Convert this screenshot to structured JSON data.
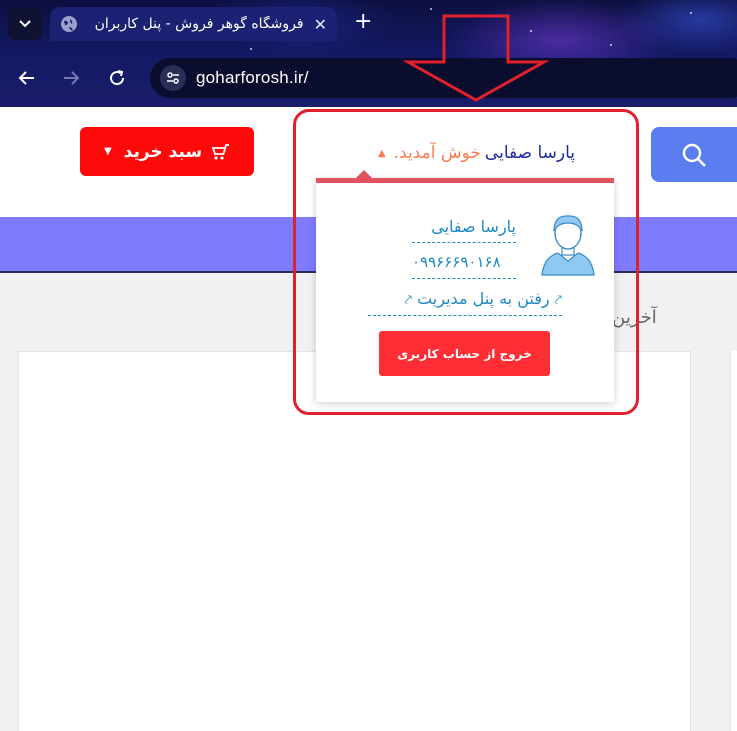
{
  "browser": {
    "tab_title": "فروشگاه گوهر فروش - پنل کاربران",
    "new_tab_symbol": "+",
    "close_symbol": "✕",
    "url": "goharforosh.ir/"
  },
  "header": {
    "cart_label": "سبد خرید",
    "cart_caret": "▼",
    "greeting_name": "پارسا صفایی",
    "greeting_welcome": "خوش آمدید.",
    "greeting_caret": "▲"
  },
  "content": {
    "latest_label": "آخرین"
  },
  "user_dropdown": {
    "name": "پارسا صفایی",
    "phone": "۰۹۹۶۶۶۹۰۱۶۸",
    "admin_link": "رفتن به پنل مدیریت",
    "admin_link_icon": "⤤",
    "logout_label": "خروج از حساب کاربری"
  },
  "colors": {
    "cart_button": "#ff0a0a",
    "search_button": "#5a7ef0",
    "nav_bar": "#7f7bff",
    "welcome_text": "#ff7a52",
    "name_text": "#1f2aa0",
    "link_text": "#1e88c8",
    "logout_button": "#ff2e34",
    "annotation": "#e0202a"
  }
}
